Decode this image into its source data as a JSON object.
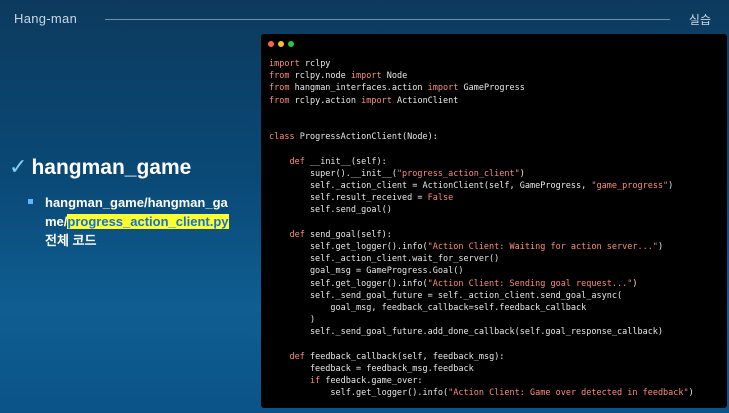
{
  "header": {
    "title": "Hang-man",
    "tag": "실습"
  },
  "bullet": {
    "title": "hangman_game",
    "sub_prefix": "hangman_game/hangman_ga me/",
    "sub_highlight": "progress_action_client.py",
    "sub_suffix": "전체 코드"
  },
  "colors": {
    "accent": "#5fb6ff",
    "highlight_bg": "#ffff2e",
    "highlight_text": "#1570d8",
    "keyword": "#ff8a7a"
  },
  "window": {
    "dots": [
      "#ff5f56",
      "#ffbd2e",
      "#27c93f"
    ]
  },
  "code_lines": [
    [
      {
        "t": "import",
        "c": "kw"
      },
      {
        "t": " rclpy"
      }
    ],
    [
      {
        "t": "from",
        "c": "kw"
      },
      {
        "t": " rclpy.node "
      },
      {
        "t": "import",
        "c": "kw"
      },
      {
        "t": " Node"
      }
    ],
    [
      {
        "t": "from",
        "c": "kw"
      },
      {
        "t": " hangman_interfaces.action "
      },
      {
        "t": "import",
        "c": "kw"
      },
      {
        "t": " GameProgress"
      }
    ],
    [
      {
        "t": "from",
        "c": "kw"
      },
      {
        "t": " rclpy.action "
      },
      {
        "t": "import",
        "c": "kw"
      },
      {
        "t": " ActionClient"
      }
    ],
    [],
    [],
    [
      {
        "t": "class",
        "c": "kw"
      },
      {
        "t": " ProgressActionClient(Node):"
      }
    ],
    [],
    [
      {
        "t": "    "
      },
      {
        "t": "def",
        "c": "kw"
      },
      {
        "t": " __init__(self):"
      }
    ],
    [
      {
        "t": "        super().__init__("
      },
      {
        "t": "\"progress_action_client\"",
        "c": "str"
      },
      {
        "t": ")"
      }
    ],
    [
      {
        "t": "        self._action_client = ActionClient(self, GameProgress, "
      },
      {
        "t": "\"game_progress\"",
        "c": "str"
      },
      {
        "t": ")"
      }
    ],
    [
      {
        "t": "        self.result_received = "
      },
      {
        "t": "False",
        "c": "kw"
      }
    ],
    [
      {
        "t": "        self.send_goal()"
      }
    ],
    [],
    [
      {
        "t": "    "
      },
      {
        "t": "def",
        "c": "kw"
      },
      {
        "t": " send_goal(self):"
      }
    ],
    [
      {
        "t": "        self.get_logger().info("
      },
      {
        "t": "\"Action Client: Waiting for action server...\"",
        "c": "str"
      },
      {
        "t": ")"
      }
    ],
    [
      {
        "t": "        self._action_client.wait_for_server()"
      }
    ],
    [
      {
        "t": "        goal_msg = GameProgress.Goal()"
      }
    ],
    [
      {
        "t": "        self.get_logger().info("
      },
      {
        "t": "\"Action Client: Sending goal request...\"",
        "c": "str"
      },
      {
        "t": ")"
      }
    ],
    [
      {
        "t": "        self._send_goal_future = self._action_client.send_goal_async("
      }
    ],
    [
      {
        "t": "            goal_msg, feedback_callback=self.feedback_callback"
      }
    ],
    [
      {
        "t": "        )"
      }
    ],
    [
      {
        "t": "        self._send_goal_future.add_done_callback(self.goal_response_callback)"
      }
    ],
    [],
    [
      {
        "t": "    "
      },
      {
        "t": "def",
        "c": "kw"
      },
      {
        "t": " feedback_callback(self, feedback_msg):"
      }
    ],
    [
      {
        "t": "        feedback = feedback_msg.feedback"
      }
    ],
    [
      {
        "t": "        "
      },
      {
        "t": "if",
        "c": "kw"
      },
      {
        "t": " feedback.game_over:"
      }
    ],
    [
      {
        "t": "            self.get_logger().info("
      },
      {
        "t": "\"Action Client: Game over detected in feedback\"",
        "c": "str"
      },
      {
        "t": ")"
      }
    ]
  ]
}
